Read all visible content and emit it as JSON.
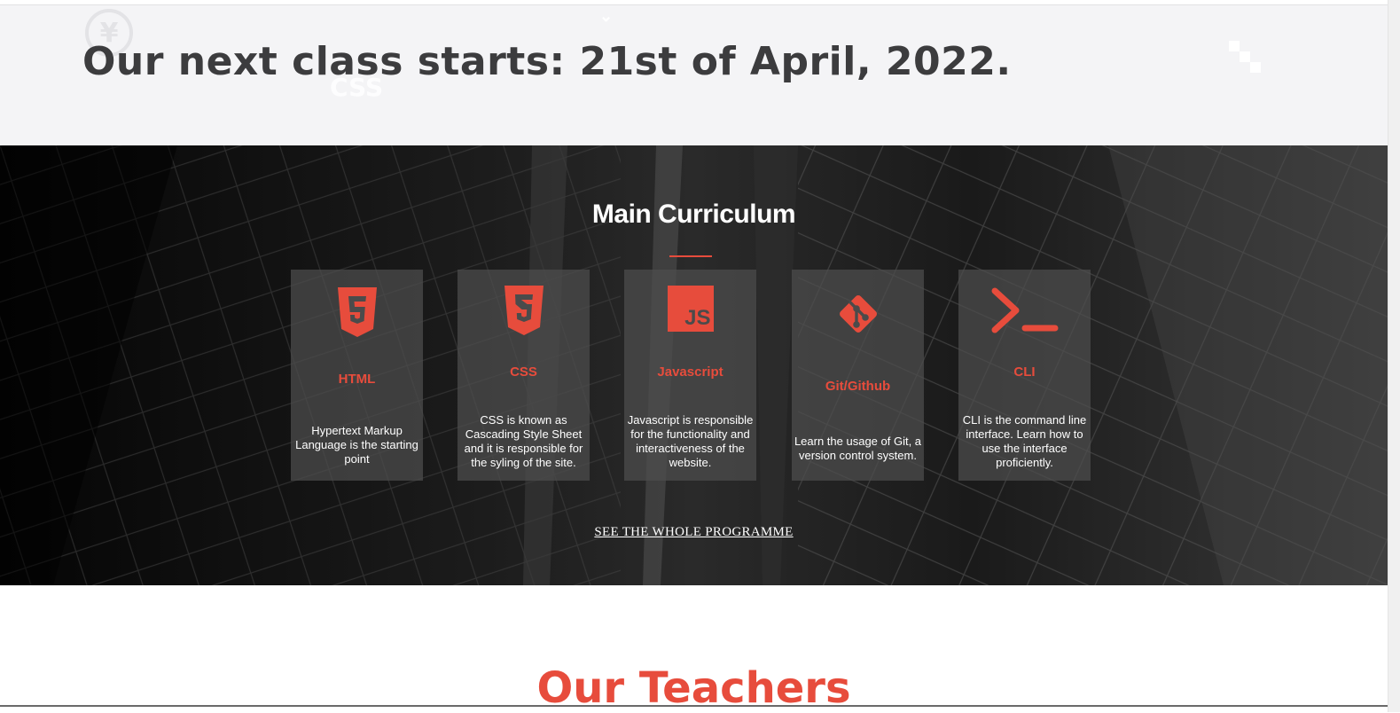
{
  "announcement": {
    "title": "Our next class starts: 21st of April, 2022.",
    "decor": {
      "yen_glyph": "¥",
      "css_glyph": "CSS",
      "chevron_glyph": "⌄"
    }
  },
  "curriculum": {
    "title": "Main Curriculum",
    "accent_color": "#e74c3c",
    "cards": [
      {
        "icon": "html5-icon",
        "title": "HTML",
        "description": "Hypertext Markup Language is the starting point"
      },
      {
        "icon": "css3-icon",
        "title": "CSS",
        "description": "CSS is known as Cascading Style Sheet and it is responsible for the syling of the site."
      },
      {
        "icon": "javascript-icon",
        "title": "Javascript",
        "description": "Javascript is responsible for the functionality and interactiveness of the website.",
        "icon_text": "JS"
      },
      {
        "icon": "git-icon",
        "title": "Git/Github",
        "description": "Learn the usage of Git, a version control system."
      },
      {
        "icon": "terminal-icon",
        "title": "CLI",
        "description": "CLI is the command line interface. Learn how to use the interface proficiently."
      }
    ],
    "link_label": "SEE THE WHOLE PROGRAMME"
  },
  "teachers": {
    "title": "Our Teachers"
  }
}
